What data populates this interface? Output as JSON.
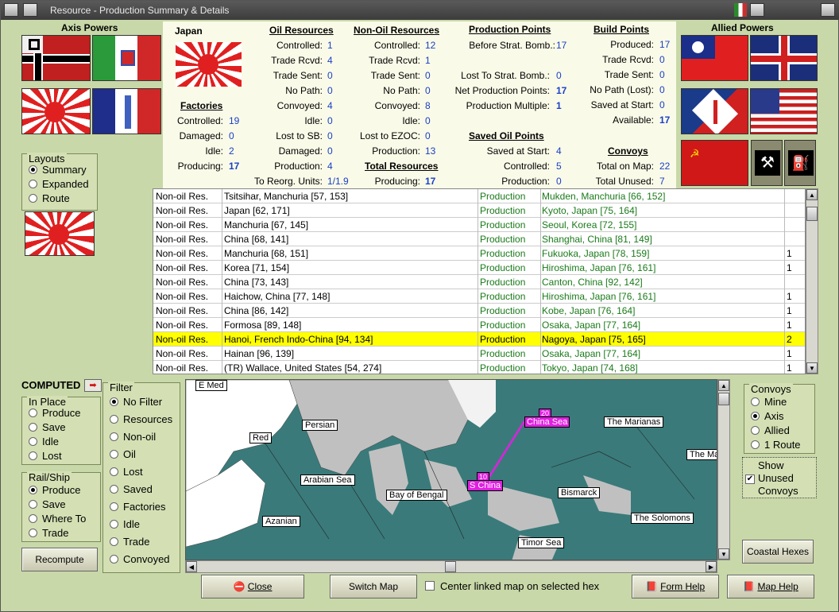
{
  "window": {
    "title": "Resource - Production Summary & Details"
  },
  "left": {
    "axis_title": "Axis Powers",
    "layouts_caption": "Layouts",
    "layouts": [
      "Summary",
      "Expanded",
      "Route"
    ]
  },
  "right": {
    "allied_title": "Allied Powers"
  },
  "japan": {
    "title": "Japan",
    "factories_title": "Factories",
    "factories": [
      [
        "Controlled:",
        "19"
      ],
      [
        "Damaged:",
        "0"
      ],
      [
        "Idle:",
        "2"
      ],
      [
        "Producing:",
        "17"
      ]
    ]
  },
  "oil": {
    "title": "Oil Resources",
    "rows": [
      [
        "Controlled:",
        "1"
      ],
      [
        "Trade Rcvd:",
        "4"
      ],
      [
        "Trade Sent:",
        "0"
      ],
      [
        "No Path:",
        "0"
      ],
      [
        "Convoyed:",
        "4"
      ],
      [
        "Idle:",
        "0"
      ],
      [
        "Lost to SB:",
        "0"
      ],
      [
        "Damaged:",
        "0"
      ],
      [
        "Production:",
        "4"
      ],
      [
        "To Reorg. Units:",
        "1/1.9"
      ]
    ]
  },
  "nonoil": {
    "title": "Non-Oil Resources",
    "rows": [
      [
        "Controlled:",
        "12"
      ],
      [
        "Trade Rcvd:",
        "1"
      ],
      [
        "Trade Sent:",
        "0"
      ],
      [
        "No Path:",
        "0"
      ],
      [
        "Convoyed:",
        "8"
      ],
      [
        "Idle:",
        "0"
      ],
      [
        "Lost to EZOC:",
        "0"
      ],
      [
        "Production:",
        "13"
      ]
    ],
    "total_title": "Total Resources",
    "total_row": [
      "Producing:",
      "17"
    ]
  },
  "pp": {
    "title": "Production Points",
    "rows": [
      [
        "Before Strat. Bomb.:",
        "17"
      ],
      [
        "Lost To Strat. Bomb.:",
        "0"
      ],
      [
        "Net Production Points:",
        "17"
      ],
      [
        "Production Multiple:",
        "1"
      ]
    ],
    "saved_title": "Saved Oil Points",
    "saved_rows": [
      [
        "Saved at Start:",
        "4"
      ],
      [
        "Controlled:",
        "5"
      ],
      [
        "Production:",
        "0"
      ]
    ]
  },
  "bp": {
    "title": "Build Points",
    "rows": [
      [
        "Produced:",
        "17"
      ],
      [
        "Trade Rcvd:",
        "0"
      ],
      [
        "Trade Sent:",
        "0"
      ],
      [
        "No Path (Lost):",
        "0"
      ],
      [
        "Saved at Start:",
        "0"
      ],
      [
        "Available:",
        "17"
      ]
    ],
    "convoys_title": "Convoys",
    "convoy_rows": [
      [
        "Total on Map:",
        "22"
      ],
      [
        "Total Unused:",
        "7"
      ]
    ]
  },
  "table": {
    "rows": [
      [
        "Non-oil Res.",
        "Tsitsihar, Manchuria [57, 153]",
        "Production",
        "Mukden, Manchuria [66, 152]",
        ""
      ],
      [
        "Non-oil Res.",
        "Japan [62, 171]",
        "Production",
        "Kyoto, Japan [75, 164]",
        ""
      ],
      [
        "Non-oil Res.",
        "Manchuria [67, 145]",
        "Production",
        "Seoul, Korea [72, 155]",
        ""
      ],
      [
        "Non-oil Res.",
        "China [68, 141]",
        "Production",
        "Shanghai, China [81, 149]",
        ""
      ],
      [
        "Non-oil Res.",
        "Manchuria [68, 151]",
        "Production",
        "Fukuoka, Japan [78, 159]",
        "1"
      ],
      [
        "Non-oil Res.",
        "Korea [71, 154]",
        "Production",
        "Hiroshima, Japan [76, 161]",
        "1"
      ],
      [
        "Non-oil Res.",
        "China [73, 143]",
        "Production",
        "Canton, China [92, 142]",
        ""
      ],
      [
        "Non-oil Res.",
        "Haichow, China [77, 148]",
        "Production",
        "Hiroshima, Japan [76, 161]",
        "1"
      ],
      [
        "Non-oil Res.",
        "China [86, 142]",
        "Production",
        "Kobe, Japan [76, 164]",
        "1"
      ],
      [
        "Non-oil Res.",
        "Formosa [89, 148]",
        "Production",
        "Osaka, Japan [77, 164]",
        "1"
      ],
      [
        "Non-oil Res.",
        "Hanoi, French Indo-China [94, 134]",
        "Production",
        "Nagoya, Japan [75, 165]",
        "2"
      ],
      [
        "Non-oil Res.",
        "Hainan [96, 139]",
        "Production",
        "Osaka, Japan [77, 164]",
        "1"
      ],
      [
        "Non-oil Res.",
        "(TR) Wallace, United States [54, 274]",
        "Production",
        "Tokyo, Japan [74, 168]",
        "1"
      ]
    ],
    "selected_index": 10
  },
  "computed": {
    "label": "COMPUTED",
    "inplace_caption": "In Place",
    "inplace": [
      "Produce",
      "Save",
      "Idle",
      "Lost"
    ],
    "railship_caption": "Rail/Ship",
    "railship": [
      "Produce",
      "Save",
      "Where To",
      "Trade"
    ],
    "recompute": "Recompute"
  },
  "filter": {
    "caption": "Filter",
    "items": [
      "No Filter",
      "Resources",
      "Non-oil",
      "Oil",
      "Lost",
      "Saved",
      "Factories",
      "Idle",
      "Trade",
      "Convoyed"
    ]
  },
  "convoys": {
    "caption": "Convoys",
    "items": [
      "Mine",
      "Axis",
      "Allied",
      "1 Route"
    ],
    "show_unused": "Show Unused Convoys",
    "coastal": "Coastal Hexes"
  },
  "map": {
    "labels": [
      "E Med",
      "Persian",
      "Red",
      "Arabian Sea",
      "Bay of Bengal",
      "Azanian",
      "The Marianas",
      "The Ma",
      "Bismarck",
      "The Solomons",
      "Timor Sea"
    ],
    "convoy_labels": [
      "China Sea",
      "S China"
    ],
    "convoy_counts": [
      "20",
      "10"
    ]
  },
  "bottom": {
    "close": "Close",
    "switch_map": "Switch Map",
    "center_linked": "Center linked map on selected hex",
    "form_help": "Form Help",
    "map_help": "Map Help"
  }
}
